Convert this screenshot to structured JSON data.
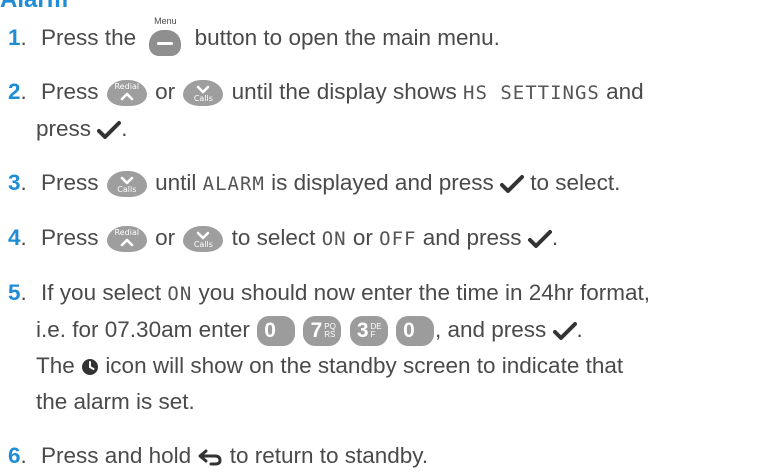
{
  "title": "Alarm",
  "keys": {
    "menu_label": "Menu",
    "redial_label": "Redial",
    "calls_label": "Calls"
  },
  "steps": [
    {
      "num": "1",
      "t1": "Press the",
      "t2": "button to open the main menu."
    },
    {
      "num": "2",
      "t1": "Press",
      "t2": "or",
      "t3": "until the display shows",
      "code": "HS SETTINGS",
      "t4": "and",
      "t5": "press",
      "t6": "."
    },
    {
      "num": "3",
      "t1": "Press",
      "t2": "until",
      "code": "ALARM",
      "t3": "is displayed and press",
      "t4": "to select."
    },
    {
      "num": "4",
      "t1": "Press",
      "t2": "or",
      "t3": "to select",
      "code1": "ON",
      "t4": "or",
      "code2": "OFF",
      "t5": "and press",
      "t6": "."
    },
    {
      "num": "5",
      "t1": "If you select",
      "code": "ON",
      "t2": "you should now enter the time in 24hr format,",
      "t3": "i.e. for 07.30am enter",
      "t4": ", and press",
      "t5": ".",
      "t6": "The",
      "t7": "icon will show on the standby screen to indicate that",
      "t8": "the alarm is set.",
      "keys": [
        {
          "digit": "0",
          "sub": ""
        },
        {
          "digit": "7",
          "sub": "PQ RS"
        },
        {
          "digit": "3",
          "sub": "DE F"
        },
        {
          "digit": "0",
          "sub": ""
        }
      ]
    },
    {
      "num": "6",
      "t1": "Press and hold",
      "t2": "to return to standby."
    }
  ]
}
